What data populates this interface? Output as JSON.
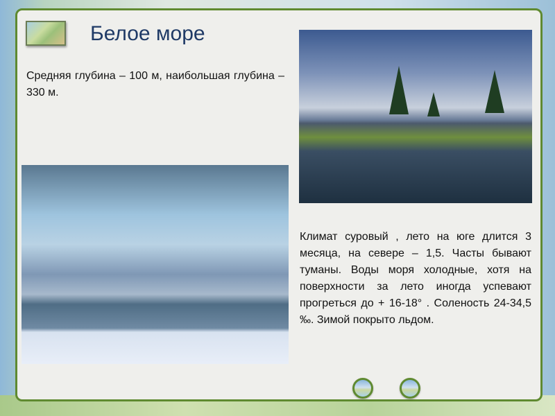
{
  "slide": {
    "title": "Белое море",
    "depth_text": "Средняя глубина – 100 м, наибольшая глубина – 330 м.",
    "climate_text": "Климат суровый , лето на юге длится 3 месяца, на севере – 1,5. Часты бывают туманы. Воды моря холодные, хотя на поверхности за лето иногда успевают прогреться до + 16-18° . Соленость 24-34,5 ‰. Зимой покрыто льдом."
  },
  "navigation": {
    "prev_icon": "landscape-button-icon",
    "next_icon": "landscape-button-icon"
  },
  "colors": {
    "title": "#1f3a66",
    "border": "#5f8a30"
  }
}
